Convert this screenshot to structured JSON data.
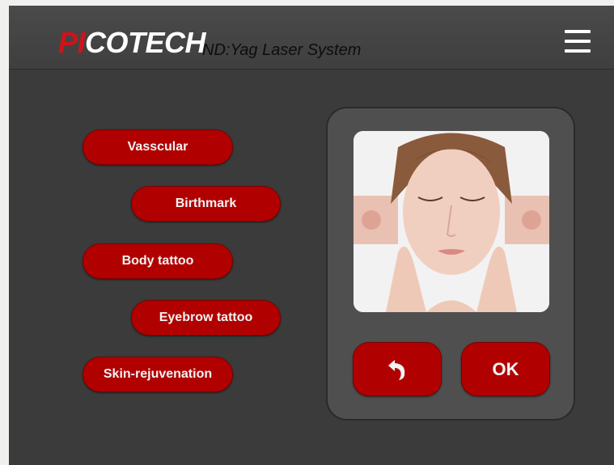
{
  "header": {
    "logo_prefix": "PI",
    "logo_rest": "COTECH",
    "subtitle": "ND:Yag Laser System",
    "menu_icon": "hamburger-menu-icon"
  },
  "treatments": [
    {
      "label": "Vasscular"
    },
    {
      "label": "Birthmark"
    },
    {
      "label": "Body tattoo"
    },
    {
      "label": "Eyebrow tattoo"
    },
    {
      "label": "Skin-rejuvenation"
    }
  ],
  "panel": {
    "back_icon": "undo-arrow-icon",
    "ok_label": "OK"
  },
  "colors": {
    "button_red": "#b10000",
    "logo_red": "#d1121a",
    "background": "#3b3b3b",
    "panel": "#4f4f4f"
  }
}
